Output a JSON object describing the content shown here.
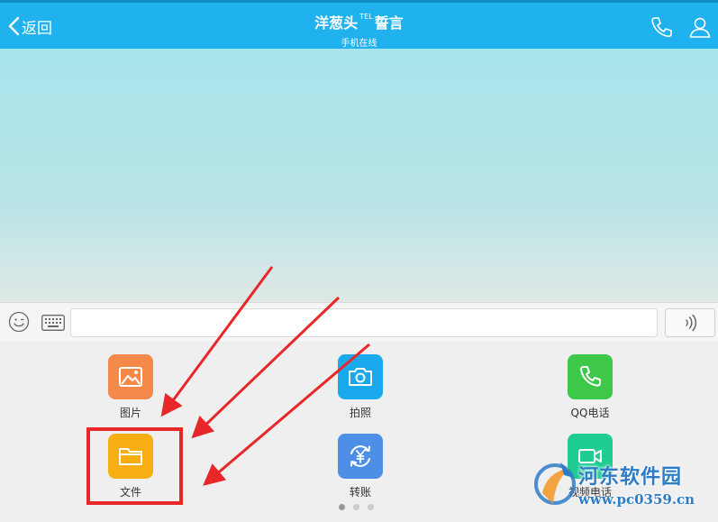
{
  "header": {
    "back_label": "返回",
    "name": "洋葱头",
    "name_sup": "TEL",
    "name_suffix": "誓言",
    "status": "手机在线",
    "icons": [
      "phone-icon",
      "person-icon"
    ]
  },
  "input_bar": {
    "icons": [
      "emoji-icon",
      "keyboard-icon",
      "voice-icon"
    ],
    "text_value": ""
  },
  "panel": {
    "tools": [
      {
        "label": "图片",
        "icon": "image-icon",
        "color": "#f5894a"
      },
      {
        "label": "拍照",
        "icon": "camera-icon",
        "color": "#1aa9ec"
      },
      {
        "label": "QQ电话",
        "icon": "phone-icon",
        "color": "#3dc84a"
      },
      {
        "label": "文件",
        "icon": "folder-icon",
        "color": "#f6ae13"
      },
      {
        "label": "转账",
        "icon": "transfer-icon",
        "color": "#4d8fe6"
      },
      {
        "label": "视频电话",
        "icon": "video-icon",
        "color": "#1fcd93"
      }
    ],
    "page_count": 3,
    "active_page": 1
  },
  "watermark": {
    "name": "河东软件园",
    "url": "www.pc0359.cn"
  },
  "colors": {
    "header": "#1fb2ee",
    "annotation": "#e8272b"
  }
}
